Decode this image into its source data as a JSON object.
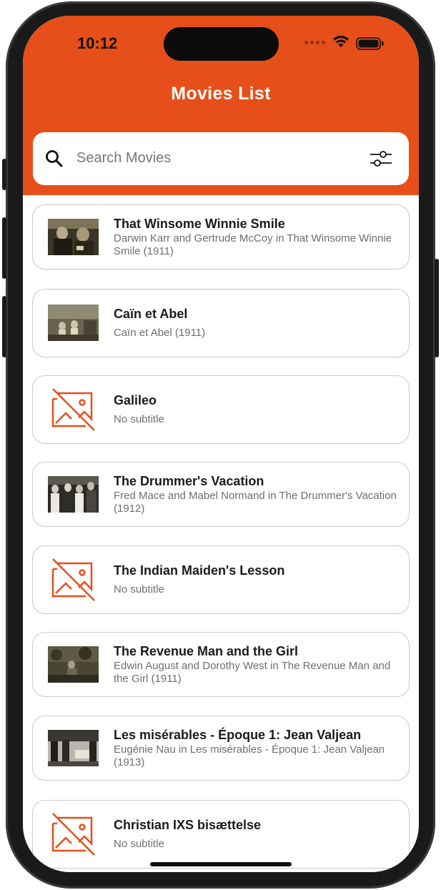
{
  "status_bar": {
    "time": "10:12"
  },
  "header": {
    "title": "Movies List",
    "color": "#e64f19"
  },
  "search": {
    "placeholder": "Search Movies",
    "icon": "search-icon",
    "filter_icon": "sliders-icon"
  },
  "movies": [
    {
      "title": "That Winsome Winnie Smile",
      "subtitle": "Darwin Karr and Gertrude McCoy in That Winsome Winnie Smile (1911)",
      "has_image": true
    },
    {
      "title": "Caïn et Abel",
      "subtitle": "Caïn et Abel (1911)",
      "has_image": true
    },
    {
      "title": "Galileo",
      "subtitle": "No subtitle",
      "has_image": false
    },
    {
      "title": "The Drummer's Vacation",
      "subtitle": "Fred Mace and Mabel Normand in The Drummer's Vacation (1912)",
      "has_image": true
    },
    {
      "title": "The Indian Maiden's Lesson",
      "subtitle": "No subtitle",
      "has_image": false
    },
    {
      "title": "The Revenue Man and the Girl",
      "subtitle": "Edwin August and Dorothy West in The Revenue Man and the Girl (1911)",
      "has_image": true
    },
    {
      "title": "Les misérables - Époque 1: Jean Valjean",
      "subtitle": "Eugénie Nau in Les misérables - Époque 1: Jean Valjean (1913)",
      "has_image": true
    },
    {
      "title": "Christian IXS bisættelse",
      "subtitle": "No subtitle",
      "has_image": false
    }
  ]
}
